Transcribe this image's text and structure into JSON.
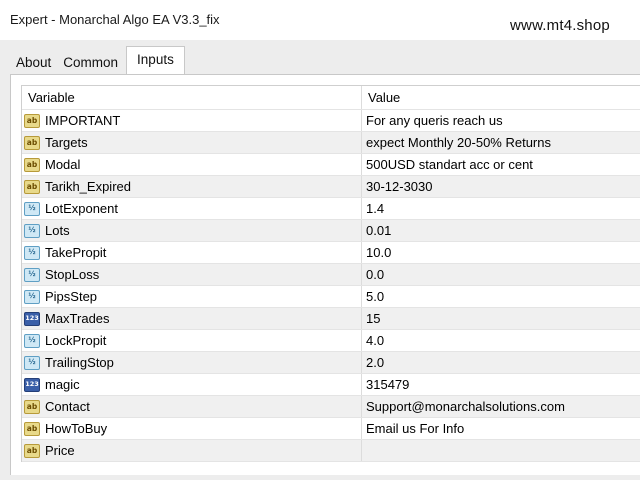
{
  "window": {
    "title": "Expert - Monarchal Algo EA V3.3_fix",
    "watermark": "www.mt4.shop"
  },
  "tabs": [
    {
      "label": "About",
      "active": false
    },
    {
      "label": "Common",
      "active": false
    },
    {
      "label": "Inputs",
      "active": true
    }
  ],
  "table": {
    "headers": {
      "variable": "Variable",
      "value": "Value"
    },
    "rows": [
      {
        "type": "ab",
        "type_label": "ab",
        "name": "IMPORTANT",
        "value": "For any queris reach us"
      },
      {
        "type": "ab",
        "type_label": "ab",
        "name": "Targets",
        "value": "expect Monthly 20-50% Returns"
      },
      {
        "type": "ab",
        "type_label": "ab",
        "name": "Modal",
        "value": "500USD standart acc or cent"
      },
      {
        "type": "ab",
        "type_label": "ab",
        "name": "Tarikh_Expired",
        "value": "30-12-3030"
      },
      {
        "type": "double",
        "type_label": "½",
        "name": "LotExponent",
        "value": "1.4"
      },
      {
        "type": "double",
        "type_label": "½",
        "name": "Lots",
        "value": "0.01"
      },
      {
        "type": "double",
        "type_label": "½",
        "name": "TakePropit",
        "value": "10.0"
      },
      {
        "type": "double",
        "type_label": "½",
        "name": "StopLoss",
        "value": "0.0"
      },
      {
        "type": "double",
        "type_label": "½",
        "name": "PipsStep",
        "value": "5.0"
      },
      {
        "type": "int",
        "type_label": "123",
        "name": "MaxTrades",
        "value": "15"
      },
      {
        "type": "double",
        "type_label": "½",
        "name": "LockPropit",
        "value": "4.0"
      },
      {
        "type": "double",
        "type_label": "½",
        "name": "TrailingStop",
        "value": "2.0"
      },
      {
        "type": "int",
        "type_label": "123",
        "name": "magic",
        "value": "315479"
      },
      {
        "type": "ab",
        "type_label": "ab",
        "name": "Contact",
        "value": "Support@monarchalsolutions.com"
      },
      {
        "type": "ab",
        "type_label": "ab",
        "name": "HowToBuy",
        "value": "Email us For Info"
      },
      {
        "type": "ab",
        "type_label": "ab",
        "name": "Price",
        "value": ""
      }
    ]
  }
}
